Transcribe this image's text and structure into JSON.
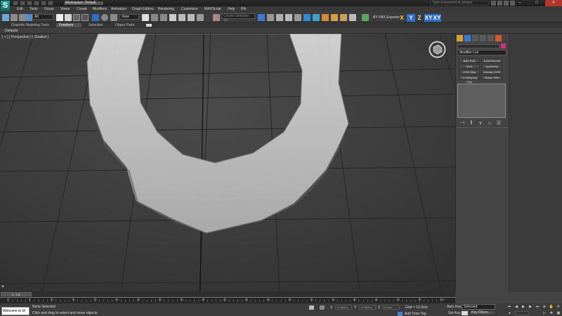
{
  "window": {
    "workspace_label": "Workspace: Default",
    "search_placeholder": "Type a keyword or phrase",
    "logo_letter": "S",
    "controls": [
      "–",
      "□",
      "✕"
    ]
  },
  "menu": {
    "items": [
      "Edit",
      "Tools",
      "Group",
      "Views",
      "Create",
      "Modifiers",
      "Animation",
      "Graph Editors",
      "Rendering",
      "Customize",
      "MAXScript",
      "Help",
      "Rhi"
    ]
  },
  "toolbar": {
    "filter_value": "All",
    "coord_system": "View",
    "selection_set_placeholder": "Create Selection Se",
    "fbx_label": "BY FBX Exporter",
    "axis_buttons": [
      "X",
      "Y",
      "Z",
      "XY",
      "XY"
    ]
  },
  "ribbon": {
    "tabs": [
      "Graphite Modeling Tools",
      "Freeform",
      "Selection",
      "Object Paint"
    ],
    "defaults_label": "Defaults"
  },
  "viewport": {
    "label": "[ + ] [ Perspective ] [ Shaded ]"
  },
  "command_panel": {
    "modifier_list": "Modifier List",
    "buttons": [
      "Bath Poly",
      "TurboSmooth",
      "Shell",
      "Symmetry",
      "UVW Map",
      "Unwrap UVW",
      "UV Mapping Clea",
      "Shape Sele"
    ],
    "stack_icons": [
      "⊣",
      "‖",
      "∨",
      "⌂",
      "☰"
    ]
  },
  "timeline": {
    "frame_counter": "0 / 100",
    "ticks": [
      "0",
      "5",
      "10",
      "15",
      "20",
      "25",
      "30",
      "35",
      "40",
      "45",
      "50",
      "55",
      "60",
      "65",
      "70",
      "75",
      "80",
      "85",
      "90",
      "95",
      "100"
    ]
  },
  "status": {
    "maxscript_text": "Welcome to M",
    "status_text": "None Selected",
    "prompt_text": "Click and drag to select and move objects",
    "x_label": "X",
    "y_label": "Y",
    "z_label": "Z",
    "x_value": "-0.000cm",
    "y_value": "-0.000cm",
    "z_value": "0.0cm",
    "grid_text": "Grid = 10.0cm",
    "time_tag": "Add Time Tag",
    "auto_key": "Auto Key",
    "set_key": "Set Key",
    "selection_mode": "Selected",
    "key_filters": "Key Filters..."
  },
  "colors": {
    "accent_teal": "#2aa6a0",
    "swatch_magenta": "#d42c85",
    "axis_highlight": "#2f6fc4"
  }
}
